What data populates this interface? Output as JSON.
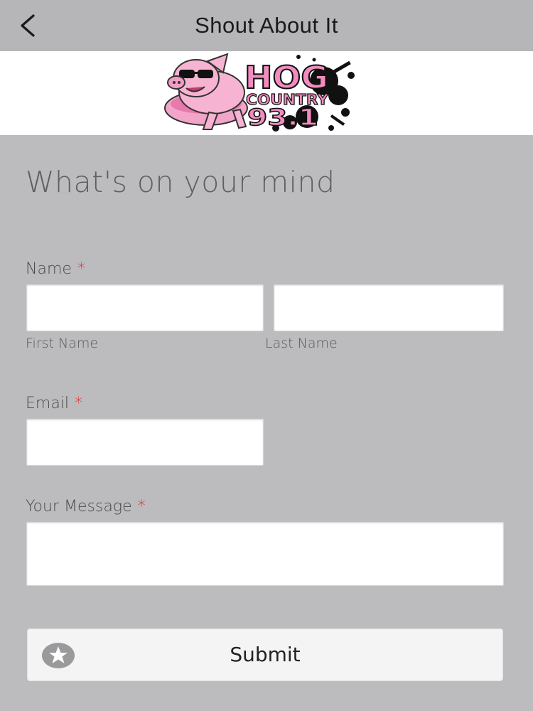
{
  "header": {
    "title": "Shout About It",
    "back_icon": "chevron-left-icon"
  },
  "logo": {
    "line1": "HOG",
    "line2": "COUNTRY",
    "line3": "93.1",
    "colors": {
      "pink": "#f28cc0",
      "black": "#111111"
    }
  },
  "form": {
    "heading": "What's on your mind",
    "name_label": "Name",
    "required_mark": "*",
    "first_name_sublabel": "First Name",
    "last_name_sublabel": "Last Name",
    "first_name_value": "",
    "last_name_value": "",
    "email_label": "Email",
    "email_value": "",
    "message_label": "Your Message",
    "message_value": "",
    "submit_label": "Submit",
    "submit_icon": "star-icon"
  },
  "colors": {
    "required": "#d32020",
    "background": "#bcbbbd",
    "topbar": "#b6b5b7"
  }
}
